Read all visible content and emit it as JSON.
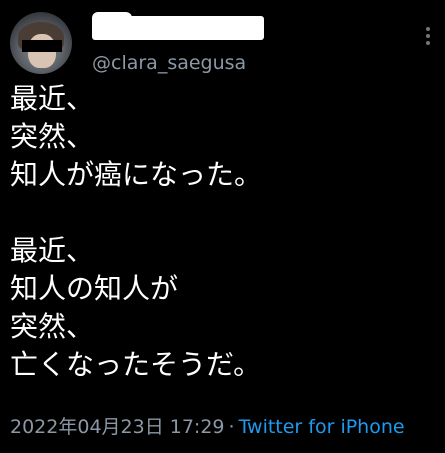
{
  "user": {
    "handle": "@clara_saegusa"
  },
  "tweet": {
    "text": "最近、\n突然、\n知人が癌になった。\n\n最近、\n知人の知人が\n突然、\n亡くなったそうだ。",
    "timestamp": "2022年04月23日 17:29",
    "separator": "·",
    "source": "Twitter for iPhone"
  },
  "icons": {
    "more": "more-vertical-icon"
  },
  "colors": {
    "background": "#000000",
    "text": "#ffffff",
    "secondary": "#8b98a5",
    "link": "#1d9bf0"
  }
}
